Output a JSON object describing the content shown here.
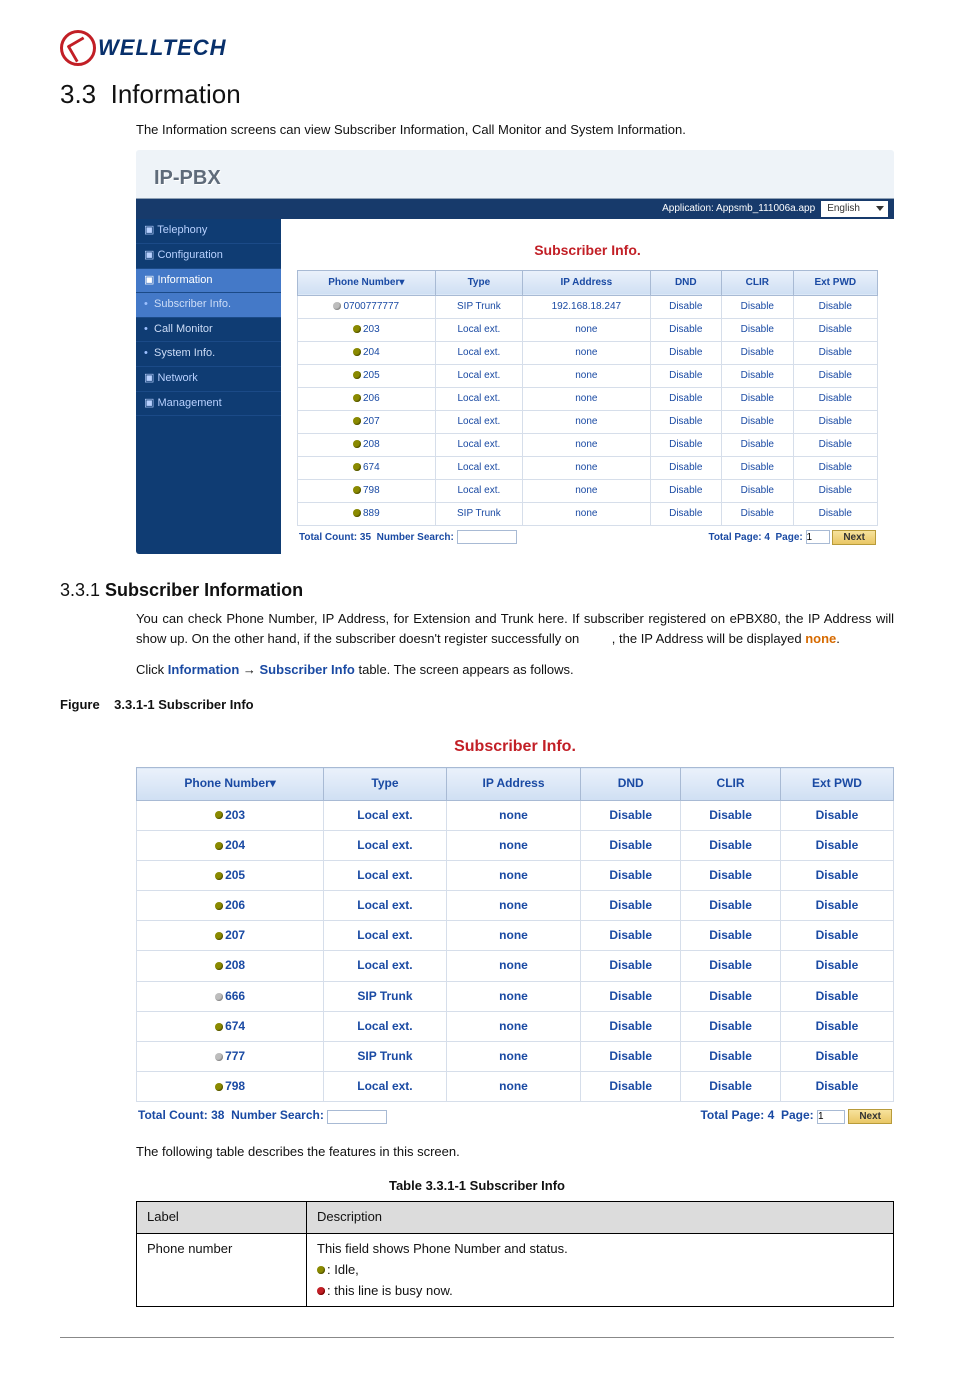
{
  "logo_text": "WELLTECH",
  "section_number_title": "3.3  Information",
  "intro": "The Information screens can view Subscriber Information, Call Monitor and System Information.",
  "ippbx_label": "IP-PBX",
  "application_label": "Application: Appsmb_111006a.app",
  "language": "English",
  "sidebar": {
    "telephony": "Telephony",
    "configuration": "Configuration",
    "information": "Information",
    "subscriber_info": "Subscriber Info.",
    "call_monitor": "Call Monitor",
    "system_info": "System Info.",
    "network": "Network",
    "management": "Management"
  },
  "panel_title": "Subscriber Info.",
  "cols": {
    "phone": "Phone Number",
    "type": "Type",
    "ip": "IP Address",
    "dnd": "DND",
    "clir": "CLIR",
    "ext": "Ext PWD"
  },
  "rows1": [
    {
      "dot": "off",
      "phone": "0700777777",
      "type": "SIP Trunk",
      "ip": "192.168.18.247",
      "dnd": "Disable",
      "clir": "Disable",
      "ext": "Disable"
    },
    {
      "dot": "idle",
      "phone": "203",
      "type": "Local ext.",
      "ip": "none",
      "dnd": "Disable",
      "clir": "Disable",
      "ext": "Disable"
    },
    {
      "dot": "idle",
      "phone": "204",
      "type": "Local ext.",
      "ip": "none",
      "dnd": "Disable",
      "clir": "Disable",
      "ext": "Disable"
    },
    {
      "dot": "idle",
      "phone": "205",
      "type": "Local ext.",
      "ip": "none",
      "dnd": "Disable",
      "clir": "Disable",
      "ext": "Disable"
    },
    {
      "dot": "idle",
      "phone": "206",
      "type": "Local ext.",
      "ip": "none",
      "dnd": "Disable",
      "clir": "Disable",
      "ext": "Disable"
    },
    {
      "dot": "idle",
      "phone": "207",
      "type": "Local ext.",
      "ip": "none",
      "dnd": "Disable",
      "clir": "Disable",
      "ext": "Disable"
    },
    {
      "dot": "idle",
      "phone": "208",
      "type": "Local ext.",
      "ip": "none",
      "dnd": "Disable",
      "clir": "Disable",
      "ext": "Disable"
    },
    {
      "dot": "idle",
      "phone": "674",
      "type": "Local ext.",
      "ip": "none",
      "dnd": "Disable",
      "clir": "Disable",
      "ext": "Disable"
    },
    {
      "dot": "idle",
      "phone": "798",
      "type": "Local ext.",
      "ip": "none",
      "dnd": "Disable",
      "clir": "Disable",
      "ext": "Disable"
    },
    {
      "dot": "idle",
      "phone": "889",
      "type": "SIP Trunk",
      "ip": "none",
      "dnd": "Disable",
      "clir": "Disable",
      "ext": "Disable"
    }
  ],
  "total_count_label": "Total Count:",
  "total_count_1": "35",
  "search_label": "Number Search:",
  "total_page_label": "Total Page:",
  "total_page_1": "4",
  "page_label": "Page:",
  "page_val": "1",
  "next_label": "Next",
  "subsection": "3.3.1 ",
  "subsection_title": "Subscriber Information",
  "para1a": "You can check Phone Number, IP Address, for Extension and Trunk here. If subscriber registered on ePBX80, the IP Address will show up. On the other hand, if the subscriber doesn't register successfully on         , the IP Address will be displayed ",
  "none_word": "none",
  "click_text": "Click ",
  "info_link": "Information",
  "arrow": " → ",
  "sub_link": "Subscriber Info",
  "click_tail": " table. The screen appears as follows.",
  "fig_caption": "Figure    3.3.1-1 Subscriber Info",
  "rows2": [
    {
      "dot": "idle",
      "phone": "203",
      "type": "Local ext.",
      "ip": "none",
      "dnd": "Disable",
      "clir": "Disable",
      "ext": "Disable"
    },
    {
      "dot": "idle",
      "phone": "204",
      "type": "Local ext.",
      "ip": "none",
      "dnd": "Disable",
      "clir": "Disable",
      "ext": "Disable"
    },
    {
      "dot": "idle",
      "phone": "205",
      "type": "Local ext.",
      "ip": "none",
      "dnd": "Disable",
      "clir": "Disable",
      "ext": "Disable"
    },
    {
      "dot": "idle",
      "phone": "206",
      "type": "Local ext.",
      "ip": "none",
      "dnd": "Disable",
      "clir": "Disable",
      "ext": "Disable"
    },
    {
      "dot": "idle",
      "phone": "207",
      "type": "Local ext.",
      "ip": "none",
      "dnd": "Disable",
      "clir": "Disable",
      "ext": "Disable"
    },
    {
      "dot": "idle",
      "phone": "208",
      "type": "Local ext.",
      "ip": "none",
      "dnd": "Disable",
      "clir": "Disable",
      "ext": "Disable"
    },
    {
      "dot": "off",
      "phone": "666",
      "type": "SIP Trunk",
      "ip": "none",
      "dnd": "Disable",
      "clir": "Disable",
      "ext": "Disable"
    },
    {
      "dot": "idle",
      "phone": "674",
      "type": "Local ext.",
      "ip": "none",
      "dnd": "Disable",
      "clir": "Disable",
      "ext": "Disable"
    },
    {
      "dot": "off",
      "phone": "777",
      "type": "SIP Trunk",
      "ip": "none",
      "dnd": "Disable",
      "clir": "Disable",
      "ext": "Disable"
    },
    {
      "dot": "idle",
      "phone": "798",
      "type": "Local ext.",
      "ip": "none",
      "dnd": "Disable",
      "clir": "Disable",
      "ext": "Disable"
    }
  ],
  "total_count_2": "38",
  "total_page_2": "4",
  "follow_text": "The following table describes the features in this screen.",
  "tbl_caption": "Table 3.3.1-1 Subscriber Info",
  "tbl": {
    "label": "Label",
    "desc": "Description",
    "r1l": "Phone number",
    "r1d": "This field shows Phone Number and status.",
    "idle": ": Idle,",
    "busy": ": this line is busy now."
  }
}
